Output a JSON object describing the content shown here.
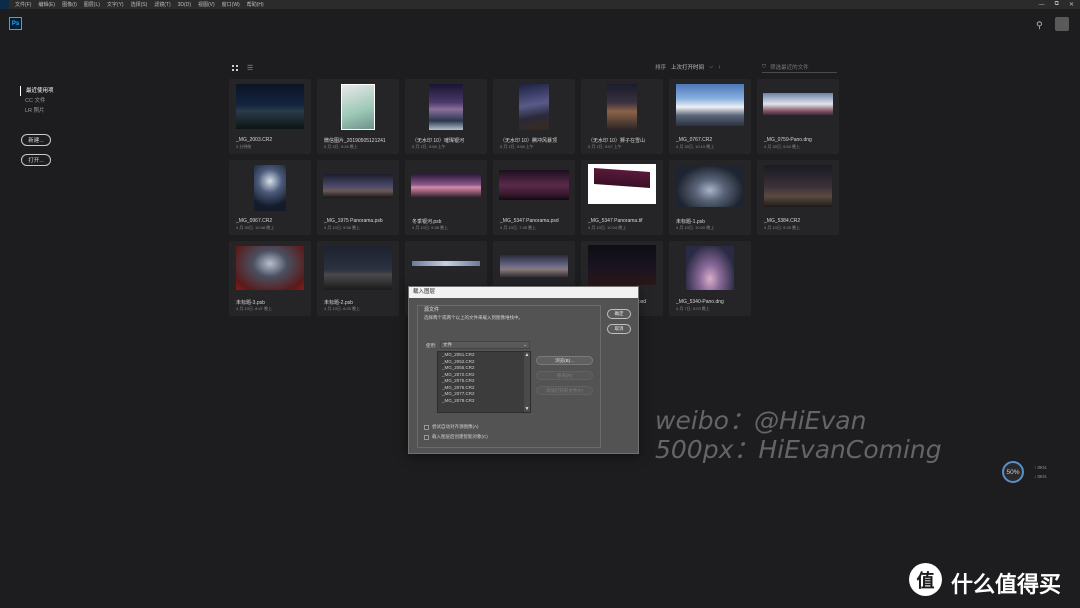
{
  "menubar": {
    "items": [
      "文件(F)",
      "编辑(E)",
      "图像(I)",
      "图层(L)",
      "文字(Y)",
      "选择(S)",
      "滤镜(T)",
      "3D(D)",
      "视图(V)",
      "窗口(W)",
      "帮助(H)"
    ],
    "controls": [
      "—",
      "⧉",
      "✕"
    ]
  },
  "app": {
    "logo": "Ps",
    "search_icon": "search-icon",
    "accent": "#31a8ff"
  },
  "leftnav": {
    "items": [
      "最近使用项",
      "CC 文件",
      "LR 照片"
    ],
    "new_button": "新建...",
    "open_button": "打开..."
  },
  "toolbar": {
    "sort_label": "排序",
    "sort_value": "上次打开时间",
    "sort_chevron": "⌵",
    "sort_arrow": "↓",
    "filter_icon": "filter-icon",
    "filter_placeholder": "筛选最近的文件"
  },
  "files": [
    {
      "name": "_MG_2003.CR2",
      "date": "3 分钟前",
      "thumb": "night-river"
    },
    {
      "name": "微信图片_20190505121241",
      "date": "5 月 5日, 9:26 晚上",
      "thumb": "sneaker"
    },
    {
      "name": "（无水印 10）璀璨银河",
      "date": "5 月 2日, 9:58 上午",
      "thumb": "milkyway-lake"
    },
    {
      "name": "（无水印 10）腾冲风暴顶",
      "date": "5 月 2日, 9:58 上午",
      "thumb": "milkyway-rock"
    },
    {
      "name": "（无水印 10）狮子在雪山",
      "date": "5 月 2日, 9:57 上午",
      "thumb": "river-dusk"
    },
    {
      "name": "_MG_0767.CR2",
      "date": "4 月 30日, 10:19 晚上",
      "thumb": "snow-mountain"
    },
    {
      "name": "_MG_0759-Pano.dng",
      "date": "4 月 30日, 9:54 晚上",
      "thumb": "mountain-pano"
    },
    {
      "name": "_MG_0967.CR2",
      "date": "4 月 30日, 10:48 晚上",
      "thumb": "tree-stars"
    },
    {
      "name": "_MG_1975 Panorama.psb",
      "date": "4 月 10日, 9:56 晚上",
      "thumb": "pano-dark"
    },
    {
      "name": "冬季银河.psb",
      "date": "4 月 10日, 9:38 晚上",
      "thumb": "pano-pink"
    },
    {
      "name": "_MG_5347 Panorama.psd",
      "date": "4 月 10日, 7:48 晚上",
      "thumb": "pano-purple"
    },
    {
      "name": "_MG_5347 Panorama.tif",
      "date": "4 月 10日, 10:04 晚上",
      "thumb": "pano-warped"
    },
    {
      "name": "未标题-1.psb",
      "date": "4 月 10日, 10:20 晚上",
      "thumb": "star-trail"
    },
    {
      "name": "_MG_5384.CR2",
      "date": "4 月 10日, 9:25 晚上",
      "thumb": "dusk-field"
    },
    {
      "name": "未标题-3.psb",
      "date": "4 月 10日, 8:47 晚上",
      "thumb": "star-trail-red"
    },
    {
      "name": "未标题-2.psb",
      "date": "4 月 10日, 8:25 晚上",
      "thumb": "dark-horizon"
    },
    {
      "name": "",
      "date": "",
      "thumb": "thin-pano"
    },
    {
      "name": "",
      "date": "",
      "thumb": "milky-arc"
    },
    {
      "name": "",
      "date": "",
      "thumb": "dark-sky"
    },
    {
      "name": "_MG_5340-Pano.dng",
      "date": "4 月 7日, 9:03 晚上",
      "thumb": "pano-glow"
    }
  ],
  "partial_label": "psd",
  "dialog": {
    "title": "载入图层",
    "group_title": "源文件",
    "description": "选择两个或两个以上的文件来载入到图像堆栈中。",
    "use_label": "使用:",
    "use_value": "文件",
    "list_items": [
      "_MG_2051.CR2",
      "_MG_2052.CR2",
      "_MG_2055.CR2",
      "_MG_2072.CR2",
      "_MG_2075.CR2",
      "_MG_2076.CR2",
      "_MG_2077.CR2",
      "_MG_2078.CR2"
    ],
    "browse": "浏览(B)...",
    "remove": "移去(R)",
    "add_open": "添加打开的文件(F)",
    "ok": "确定",
    "cancel": "取消",
    "check1": "尝试自动对齐源图像(A)",
    "check2": "载入图层后创建智能对象(C)"
  },
  "watermark": {
    "line1": "weibo：@HiEvan",
    "line2": "500px：HiEvanComing"
  },
  "progress": {
    "percent": "50%",
    "value": 0.5,
    "up": "0K/s",
    "down": "0K/s"
  },
  "brand": {
    "circle": "值",
    "text": "什么值得买"
  }
}
